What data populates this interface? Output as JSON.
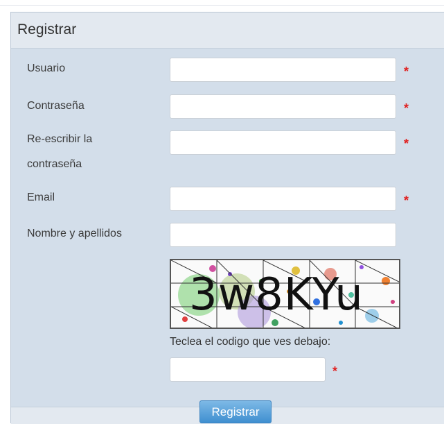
{
  "form": {
    "title": "Registrar",
    "fields": {
      "usuario": {
        "label": "Usuario",
        "value": ""
      },
      "password": {
        "label": "Contraseña",
        "value": ""
      },
      "password2": {
        "label_line1": "Re-escribir la",
        "label_line2": "contraseña",
        "value": ""
      },
      "email": {
        "label": "Email",
        "value": ""
      },
      "nombre": {
        "label": "Nombre y apellidos",
        "value": ""
      }
    },
    "required_mark": "*",
    "captcha": {
      "code": "3w8KYu",
      "hint": "Teclea el codigo que ves debajo:",
      "value": ""
    },
    "submit_label": "Registrar"
  },
  "colors": {
    "panel_bg": "#d3deea",
    "header_bg": "#e3e9f0",
    "required": "#e02020",
    "button": "#3f8fd0"
  }
}
